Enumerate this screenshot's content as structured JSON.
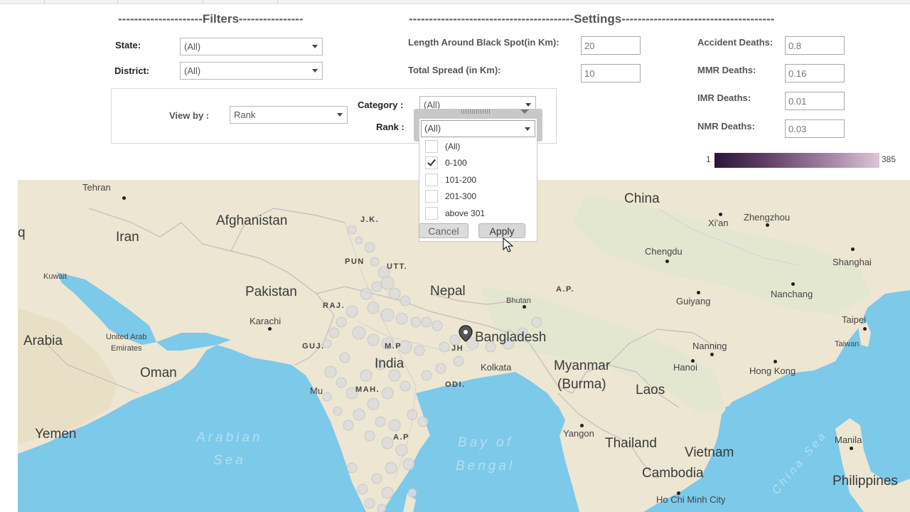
{
  "filters": {
    "title": "---------------------Filters----------------",
    "state_label": "State:",
    "state_value": "(All)",
    "district_label": "District:",
    "district_value": "(All)"
  },
  "settings": {
    "title": "-----------------------------------------Settings--------------------------------------",
    "length_label": "Length Around Black Spot(in Km):",
    "length_value": "20",
    "spread_label": "Total Spread (in Km):",
    "spread_value": "10",
    "accident_label": "Accident Deaths:",
    "accident_value": "0.8",
    "mmr_label": "MMR Deaths:",
    "mmr_value": "0.16",
    "imr_label": "IMR Deaths:",
    "imr_value": "0.01",
    "nmr_label": "NMR Deaths:",
    "nmr_value": "0.03"
  },
  "view": {
    "view_by_label": "View by :",
    "view_by_value": "Rank",
    "category_label": "Category :",
    "category_value": "(All)",
    "rank_label": "Rank :",
    "rank_value": "(All)"
  },
  "legend": {
    "min": "1",
    "max": "385",
    "color_start": "#2a1737",
    "color_end": "#dcc6d6"
  },
  "rank_dropdown": {
    "selected": "(All)",
    "options": [
      {
        "label": "(All)",
        "checked": false
      },
      {
        "label": "0-100",
        "checked": true
      },
      {
        "label": "101-200",
        "checked": false
      },
      {
        "label": "201-300",
        "checked": false
      },
      {
        "label": "above 301",
        "checked": false
      }
    ],
    "cancel_label": "Cancel",
    "apply_label": "Apply"
  },
  "map": {
    "countries": [
      "China",
      "Afghanistan",
      "Iran",
      "Pakistan",
      "Nepal",
      "Bhutan",
      "Bangladesh",
      "India",
      "Myanmar",
      "(Burma)",
      "Laos",
      "Thailand",
      "Vietnam",
      "Cambodia",
      "Oman",
      "Yemen",
      "Arabia",
      "Philippines",
      "q"
    ],
    "cities": [
      "Tehran",
      "Kuwait",
      "Karachi",
      "United Arab",
      "Emirates",
      "Xi'an",
      "Zhengzhou",
      "Chengdu",
      "Shanghai",
      "Nanchang",
      "Guiyang",
      "Taipei",
      "Taiwan",
      "Nanning",
      "Hanoi",
      "Hong Kong",
      "Kolkata",
      "Yangon",
      "Manila",
      "Ho Chi Minh City",
      "Mu"
    ],
    "states": [
      "J.K.",
      "PUN",
      "UTT.",
      "RAJ.",
      "GUJ.",
      "M.P",
      "JH",
      "ODI.",
      "MAH.",
      "A.P",
      "A.P."
    ],
    "seas": [
      "Arabian",
      "Sea",
      "Bay of",
      "Bengal",
      "China Sea"
    ]
  }
}
